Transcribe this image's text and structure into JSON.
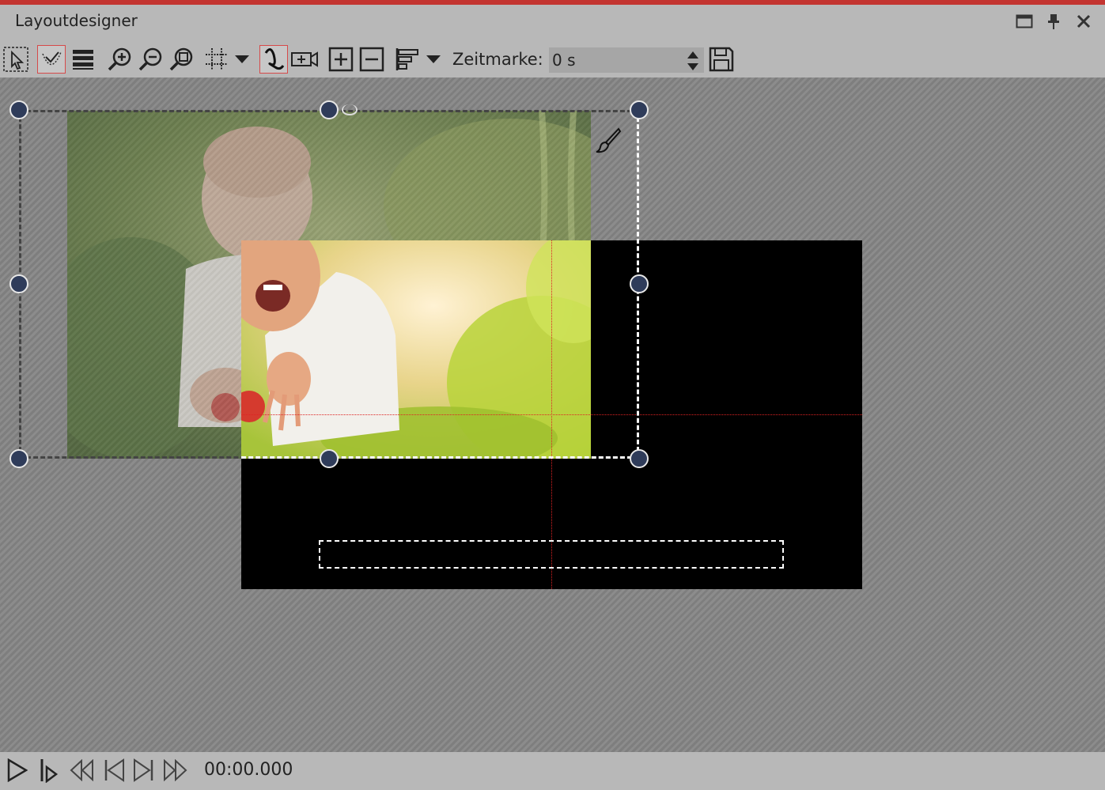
{
  "window": {
    "title": "Layoutdesigner",
    "accent_color": "#c33430"
  },
  "toolbar": {
    "tools": [
      {
        "id": "select-tool",
        "icon": "selection-arrow-icon"
      },
      {
        "id": "curve-tool",
        "icon": "dotted-curve-icon",
        "active": true
      },
      {
        "id": "layers-tool",
        "icon": "layers-stack-icon"
      },
      {
        "id": "zoom-in",
        "icon": "zoom-in-icon"
      },
      {
        "id": "zoom-out",
        "icon": "zoom-out-icon"
      },
      {
        "id": "zoom-fit",
        "icon": "zoom-fit-icon"
      },
      {
        "id": "grid",
        "icon": "grid-icon"
      },
      {
        "id": "motion-path",
        "icon": "motion-path-icon",
        "active": true
      },
      {
        "id": "camera",
        "icon": "camera-icon"
      },
      {
        "id": "add",
        "icon": "plus-box-icon"
      },
      {
        "id": "remove",
        "icon": "minus-box-icon"
      },
      {
        "id": "align",
        "icon": "align-icon"
      },
      {
        "id": "save",
        "icon": "save-icon"
      }
    ],
    "zeitmarke_label": "Zeitmarke:",
    "zeitmarke_value": "0 s"
  },
  "canvas": {
    "stage_color": "#000000",
    "guide_color": "#dd2222",
    "handle_color": "#2f3c5a"
  },
  "playback": {
    "time": "00:00.000",
    "buttons": [
      "play-icon",
      "play-from-marker-icon",
      "rewind-icon",
      "skip-start-icon",
      "skip-end-icon",
      "fast-forward-icon"
    ]
  }
}
